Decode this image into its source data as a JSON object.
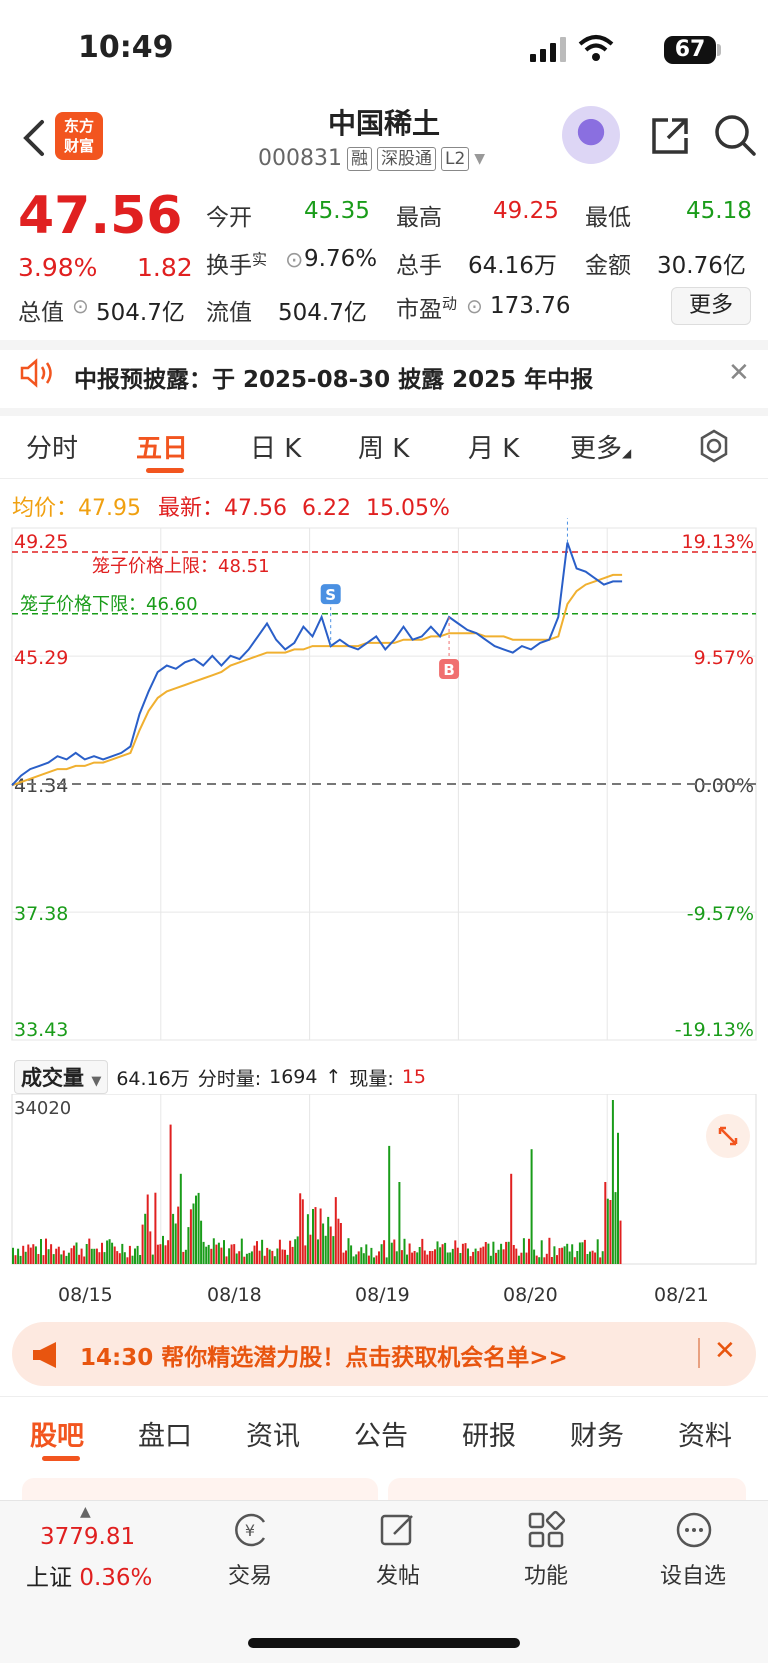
{
  "status": {
    "time": "10:49",
    "battery": "67"
  },
  "header": {
    "logo_line1": "东方",
    "logo_line2": "财富",
    "stock_name": "中国稀土",
    "stock_code": "000831",
    "tags": [
      "融",
      "深股通",
      "L2"
    ]
  },
  "quote": {
    "price": "47.56",
    "change_pct": "3.98%",
    "change": "1.82",
    "open_label": "今开",
    "open": "45.35",
    "high_label": "最高",
    "high": "49.25",
    "low_label": "最低",
    "low": "45.18",
    "turnover_label": "换手",
    "turnover_sup": "实",
    "turnover": "9.76%",
    "volume_label": "总手",
    "volume": "64.16万",
    "amount_label": "金额",
    "amount": "30.76亿",
    "mktcap_label": "总值",
    "mktcap": "504.7亿",
    "float_label": "流值",
    "float": "504.7亿",
    "pe_label": "市盈",
    "pe_sup": "动",
    "pe": "173.76",
    "more": "更多"
  },
  "notice": {
    "text": "中报预披露：于 2025-08-30 披露 2025 年中报"
  },
  "period_tabs": [
    "分时",
    "五日",
    "日 K",
    "周 K",
    "月 K",
    "更多"
  ],
  "legend": {
    "avg_label": "均价：",
    "avg": "47.95",
    "last_label": "最新：",
    "last": "47.56",
    "chg": "6.22",
    "chg_pct": "15.05%"
  },
  "chart_data": {
    "type": "line",
    "title": "",
    "y_left_ticks": [
      "49.25",
      "45.29",
      "41.34",
      "37.38",
      "33.43"
    ],
    "y_right_ticks": [
      "19.13%",
      "9.57%",
      "0.00%",
      "-9.57%",
      "-19.13%"
    ],
    "ylim": [
      33.43,
      49.25
    ],
    "prev_close": 41.34,
    "upper_limit_label": "笼子价格上限：48.51",
    "upper_limit": 48.51,
    "lower_limit_label": "笼子价格下限：46.60",
    "lower_limit": 46.6,
    "days": [
      "08/15",
      "08/18",
      "08/19",
      "08/20",
      "08/21"
    ],
    "series": [
      {
        "values": [
          41.3,
          41.6,
          41.8,
          41.9,
          42.0,
          42.2,
          42.1,
          42.3,
          42.1,
          42.2,
          42.1,
          42.2,
          42.3,
          42.5,
          43.5,
          44.2,
          44.8,
          45.0,
          44.9,
          45.1,
          45.2,
          45.0,
          45.3,
          45.0,
          45.3,
          45.2,
          45.5,
          45.9,
          46.3,
          45.8,
          45.5,
          45.7,
          46.2,
          45.9,
          46.5,
          45.6,
          45.8,
          45.6,
          45.5,
          45.7,
          45.9,
          45.5,
          45.8,
          46.2,
          45.8,
          45.9,
          46.2,
          45.9,
          46.5,
          46.3,
          46.1,
          46.0,
          45.8,
          45.6,
          45.5,
          45.4,
          45.6,
          45.5,
          45.7,
          45.8,
          46.5,
          48.8,
          48.0,
          47.9,
          47.7,
          47.5,
          47.6,
          47.6
        ]
      },
      {
        "values": [
          41.3,
          41.4,
          41.5,
          41.6,
          41.7,
          41.8,
          41.8,
          41.9,
          41.9,
          42.0,
          42.0,
          42.1,
          42.2,
          42.3,
          43.0,
          43.6,
          44.0,
          44.2,
          44.3,
          44.4,
          44.5,
          44.6,
          44.7,
          44.8,
          45.0,
          45.1,
          45.2,
          45.3,
          45.4,
          45.4,
          45.4,
          45.5,
          45.5,
          45.6,
          45.6,
          45.6,
          45.6,
          45.6,
          45.6,
          45.7,
          45.7,
          45.7,
          45.7,
          45.8,
          45.8,
          45.8,
          45.9,
          45.9,
          46.0,
          46.0,
          46.0,
          46.0,
          45.9,
          45.9,
          45.9,
          45.8,
          45.8,
          45.8,
          45.8,
          45.8,
          45.9,
          46.9,
          47.3,
          47.5,
          47.6,
          47.7,
          47.8,
          47.8
        ]
      }
    ],
    "markers": [
      "S",
      "B",
      "S"
    ]
  },
  "volume": {
    "selector": "成交量",
    "total": "64.16万",
    "minute_label": "分时量:",
    "minute": "1694",
    "arrow": "↑",
    "current_label": "现量:",
    "current": "15",
    "max_tick": "34020"
  },
  "ad": {
    "text": "14:30 帮你精选潜力股！点击获取机会名单>>"
  },
  "bottom_tabs": [
    "股吧",
    "盘口",
    "资讯",
    "公告",
    "研报",
    "财务",
    "资料"
  ],
  "bottom_bar": {
    "index_value": "3779.81",
    "index_name": "上证",
    "index_pct": "0.36%",
    "items": [
      "交易",
      "发帖",
      "功能",
      "设自选"
    ]
  },
  "colors": {
    "up": "#e02020",
    "down": "#1a9c1a",
    "avg": "#f0b030",
    "price": "#2a5fc8",
    "accent": "#f2551f"
  }
}
